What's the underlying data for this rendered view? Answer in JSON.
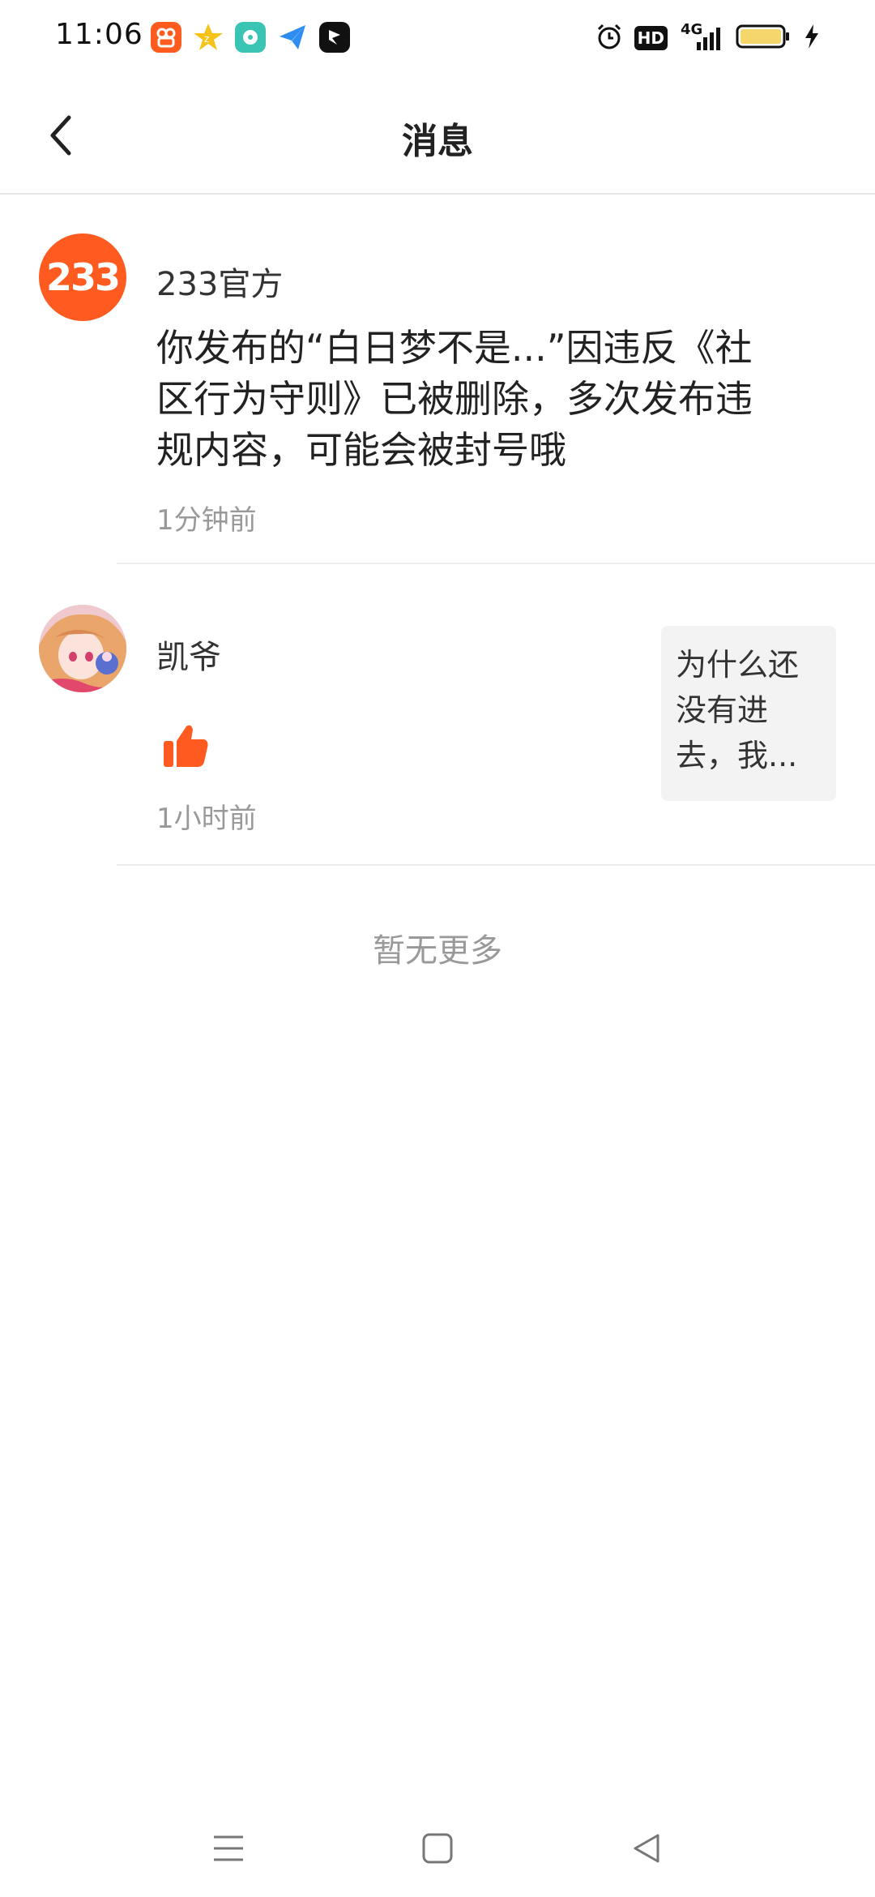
{
  "status_bar": {
    "time": "11:06",
    "network": "4G",
    "hd_label": "HD",
    "battery_level_fraction": 0.8,
    "app_icons": [
      "kuaishou-icon",
      "qq-zone-icon",
      "music-icon",
      "paper-plane-icon",
      "flag-app-icon"
    ]
  },
  "nav": {
    "title": "消息"
  },
  "messages": [
    {
      "sender": "233官方",
      "avatar_text": "233",
      "content": "你发布的“白日梦不是...”因违反《社区行为守则》已被删除，多次发布违规内容，可能会被封号哦",
      "content_lines": [
        "你发布的“白日梦不是...”因违反《社",
        "区行为守则》已被删除，多次发布违",
        "规内容，可能会被封号哦"
      ],
      "time": "1分钟前"
    },
    {
      "sender": "凯爷",
      "icon": "thumbs-up-icon",
      "time": "1小时前",
      "quote": "为什么还没有进去，我..."
    }
  ],
  "footer": {
    "no_more": "暂无更多"
  },
  "colors": {
    "accent_orange": "#ff5a1f",
    "text_primary": "#222222",
    "text_secondary": "#999999",
    "divider": "#eeeeee"
  }
}
